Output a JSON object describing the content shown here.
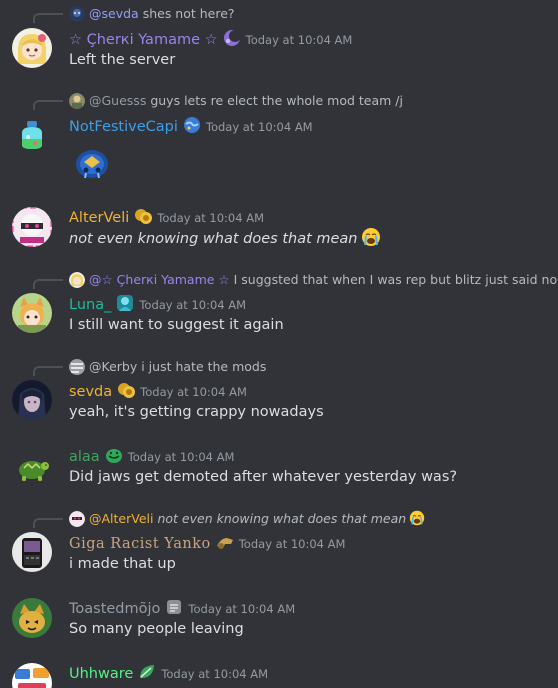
{
  "messages": [
    {
      "reply": {
        "author": "@sevda",
        "content": "shes not here?",
        "author_color": "#949cf7",
        "italic": false
      },
      "author": "☆ Çherкi Yamame ☆",
      "author_color": "#9b84ec",
      "timestamp": "Today at 10:04 AM",
      "content": "Left the server",
      "avatar_icon": "blonde-girl-avatar"
    },
    {
      "reply": {
        "author": "@Guesss",
        "content": "guys lets re elect the whole mod team /j",
        "author_color": "#949ba4",
        "italic": false
      },
      "author": "NotFestiveCapi",
      "author_color": "#3ba0e5",
      "timestamp": "Today at 10:04 AM",
      "content": "",
      "sticker": "sad-pufferfish-emoji",
      "avatar_icon": "potion-bottle-avatar"
    },
    {
      "author": "AlterVeli",
      "author_color": "#f0b232",
      "timestamp": "Today at 10:04 AM",
      "content": "not even knowing what does that mean",
      "content_italic": true,
      "content_emoji": "loudly-crying-emoji",
      "avatar_icon": "pink-masked-avatar"
    },
    {
      "reply": {
        "author": "@☆ Çherкi Yamame ☆",
        "content": "I suggsted that when I was rep but blitz just said no",
        "author_color": "#9b84ec",
        "italic": false
      },
      "author": "Luna_",
      "author_color": "#1abc9c",
      "timestamp": "Today at 10:04 AM",
      "content": "I still want to suggest it again",
      "avatar_icon": "fox-girl-avatar"
    },
    {
      "reply": {
        "author": "@Kerby",
        "content": "i just hate the mods",
        "author_color": "#b5bac1",
        "italic": false
      },
      "author": "sevda",
      "author_color": "#f0b232",
      "timestamp": "Today at 10:04 AM",
      "content": "yeah, it's getting crappy nowadays",
      "avatar_icon": "dark-hair-girl-avatar"
    },
    {
      "author": "alaa",
      "author_color": "#3ba55d",
      "timestamp": "Today at 10:04 AM",
      "content": "Did jaws get demoted after whatever yesterday was?",
      "avatar_icon": "turtle-avatar"
    },
    {
      "reply": {
        "author": "@AlterVeli",
        "content": "not even knowing what does that mean",
        "author_color": "#f0b232",
        "italic": true,
        "emoji": "loudly-crying-emoji"
      },
      "author": "Giga Racist Yanko",
      "author_color": "#c8a57e",
      "timestamp": "Today at 10:04 AM",
      "content": "i made that up",
      "avatar_icon": "phone-avatar"
    },
    {
      "author": "Toastedmõjo",
      "author_color": "#949ba4",
      "timestamp": "Today at 10:04 AM",
      "content": "So many people leaving",
      "avatar_icon": "cat-avatar"
    },
    {
      "author": "Uhhware",
      "author_color": "#57f287",
      "timestamp": "Today at 10:04 AM",
      "content": "",
      "avatar_icon": "stickers-avatar"
    }
  ],
  "colors": {
    "background": "#313338",
    "text": "#dbdee1",
    "muted": "#949ba4",
    "reply_line": "#4e5058"
  }
}
